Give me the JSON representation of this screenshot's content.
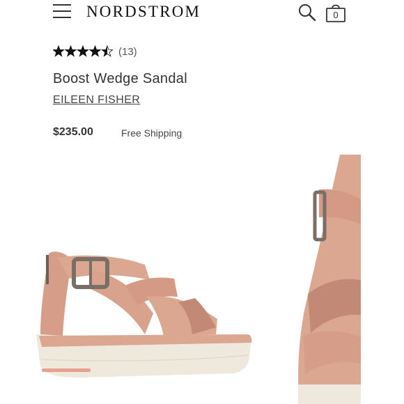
{
  "header": {
    "menu_icon": "hamburger-menu-icon",
    "logo": "NORDSTROM",
    "search_icon": "search-icon",
    "bag_icon": "shopping-bag-icon",
    "bag_count": "0"
  },
  "product": {
    "rating": 4.5,
    "rating_max": 5,
    "review_count": "(13)",
    "title": "Boost Wedge Sandal",
    "brand": "EILEEN FISHER",
    "price": "$235.00",
    "shipping": "Free Shipping"
  },
  "gallery": {
    "images": [
      "sandal-side-view",
      "sandal-detail-closeup"
    ]
  },
  "colors": {
    "sandal_blush": "#dca791",
    "sandal_shadow": "#c28a76",
    "sole_cream": "#efe9dd",
    "sole_stripe": "#e8a18f",
    "buckle": "#7a6f66"
  }
}
